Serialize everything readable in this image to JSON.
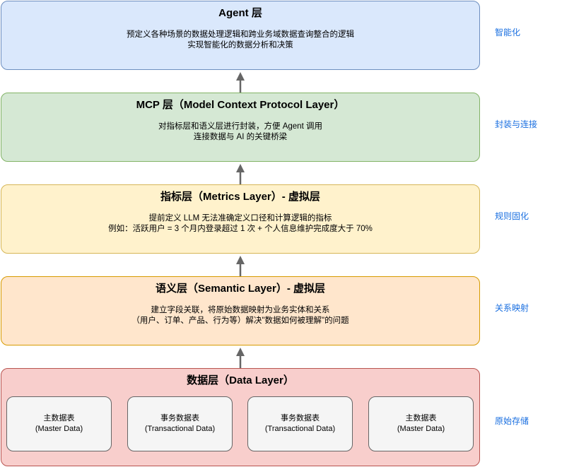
{
  "layers": {
    "agent": {
      "title": "Agent 层",
      "desc": [
        "预定义各种场景的数据处理逻辑和跨业务域数据查询整合的逻辑",
        "实现智能化的数据分析和决策"
      ],
      "side": "智能化"
    },
    "mcp": {
      "title": "MCP 层（Model Context Protocol Layer）",
      "desc": [
        "对指标层和语义层进行封装，方便 Agent 调用",
        "连接数据与 AI 的关键桥梁"
      ],
      "side": "封装与连接"
    },
    "metrics": {
      "title": "指标层（Metrics Layer）- 虚拟层",
      "desc": [
        "提前定义 LLM 无法准确定义口径和计算逻辑的指标",
        "例如：活跃用户 = 3 个月内登录超过 1 次 + 个人信息维护完成度大于 70%"
      ],
      "side": "规则固化"
    },
    "semantic": {
      "title": "语义层（Semantic Layer）- 虚拟层",
      "desc": [
        "建立字段关联，将原始数据映射为业务实体和关系",
        "（用户、订单、产品、行为等）解决\"数据如何被理解\"的问题"
      ],
      "side": "关系映射"
    },
    "data": {
      "title": "数据层（Data Layer）",
      "side": "原始存储",
      "boxes": [
        {
          "line1": "主数据表",
          "line2": "(Master Data)"
        },
        {
          "line1": "事务数据表",
          "line2": "(Transactional Data)"
        },
        {
          "line1": "事务数据表",
          "line2": "(Transactional Data)"
        },
        {
          "line1": "主数据表",
          "line2": "(Master Data)"
        }
      ]
    }
  },
  "colors": {
    "agent_fill": "#dae8fc",
    "mcp_fill": "#d5e8d4",
    "metrics_fill": "#fff2cc",
    "semantic_fill": "#ffe6cc",
    "data_fill": "#f8cecc",
    "side_label": "#1a6fe0",
    "arrow": "#666666"
  }
}
